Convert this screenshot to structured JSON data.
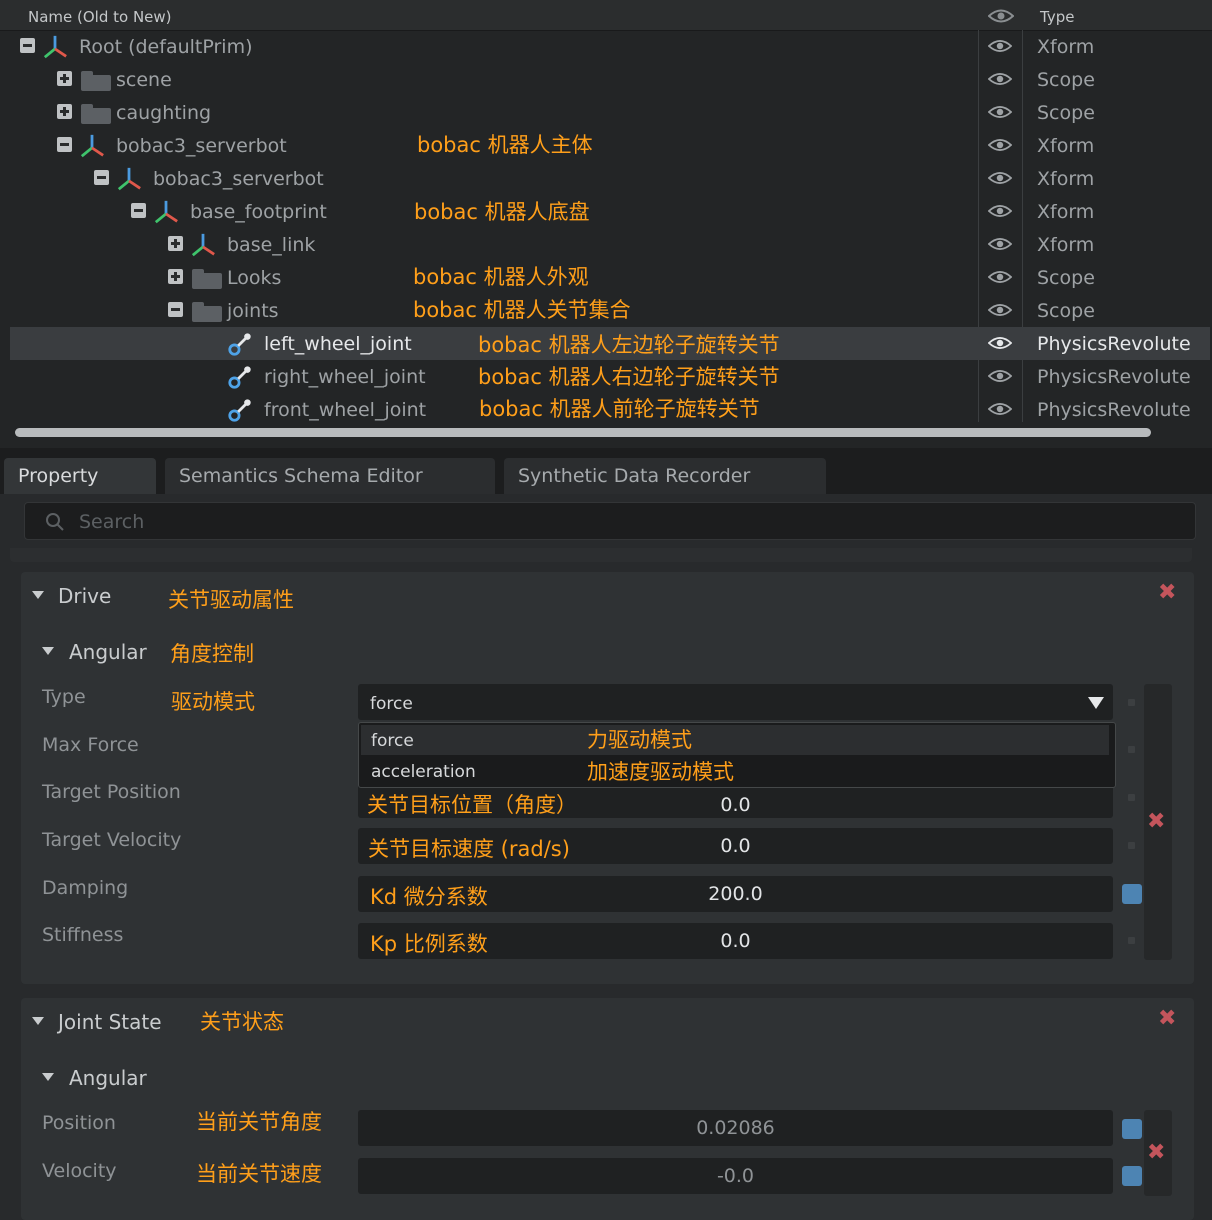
{
  "stage": {
    "columns": {
      "name": "Name (Old to New)",
      "type": "Type"
    },
    "rows": [
      {
        "name": "Root (defaultPrim)",
        "type": "Xform",
        "icon": "xform-axes-icon",
        "expander": "minus"
      },
      {
        "name": "scene",
        "type": "Scope",
        "icon": "folder-icon",
        "expander": "plus"
      },
      {
        "name": "caughting",
        "type": "Scope",
        "icon": "folder-icon",
        "expander": "plus"
      },
      {
        "name": "bobac3_serverbot",
        "type": "Xform",
        "icon": "xform-axes-icon",
        "expander": "minus"
      },
      {
        "name": "bobac3_serverbot",
        "type": "Xform",
        "icon": "xform-axes-icon",
        "expander": "minus"
      },
      {
        "name": "base_footprint",
        "type": "Xform",
        "icon": "xform-axes-icon",
        "expander": "minus"
      },
      {
        "name": "base_link",
        "type": "Xform",
        "icon": "xform-axes-icon",
        "expander": "plus"
      },
      {
        "name": "Looks",
        "type": "Scope",
        "icon": "folder-icon",
        "expander": "plus"
      },
      {
        "name": "joints",
        "type": "Scope",
        "icon": "folder-icon",
        "expander": "minus"
      },
      {
        "name": "left_wheel_joint",
        "type": "PhysicsRevolute",
        "icon": "joint-icon",
        "selected": true
      },
      {
        "name": "right_wheel_joint",
        "type": "PhysicsRevolute",
        "icon": "joint-icon"
      },
      {
        "name": "front_wheel_joint",
        "type": "PhysicsRevolute",
        "icon": "joint-icon"
      }
    ],
    "annotations": {
      "main_body": "bobac 机器人主体",
      "chassis": "bobac 机器人底盘",
      "looks": "bobac 机器人外观",
      "joints": "bobac 机器人关节集合",
      "left_wheel": "bobac 机器人左边轮子旋转关节",
      "right_wheel": "bobac 机器人右边轮子旋转关节",
      "front_wheel": "bobac 机器人前轮子旋转关节"
    }
  },
  "tabs": [
    "Property",
    "Semantics Schema Editor",
    "Synthetic Data Recorder"
  ],
  "search": {
    "placeholder": "Search"
  },
  "drive": {
    "title": "Drive",
    "title_note": "关节驱动属性",
    "angular_title": "Angular",
    "angular_note": "角度控制",
    "type": {
      "label": "Type",
      "note": "驱动模式",
      "value": "force"
    },
    "dropdown_options": [
      {
        "label": "force",
        "note": "力驱动模式"
      },
      {
        "label": "acceleration",
        "note": "加速度驱动模式"
      }
    ],
    "max_force": {
      "label": "Max Force"
    },
    "target_position": {
      "label": "Target Position",
      "note": "关节目标位置（角度）",
      "value": "0.0"
    },
    "target_velocity": {
      "label": "Target Velocity",
      "note": "关节目标速度 (rad/s)",
      "value": "0.0"
    },
    "damping": {
      "label": "Damping",
      "note": "Kd 微分系数",
      "value": "200.0"
    },
    "stiffness": {
      "label": "Stiffness",
      "note": "Kp 比例系数",
      "value": "0.0"
    }
  },
  "joint_state": {
    "title": "Joint State",
    "title_note": "关节状态",
    "angular_title": "Angular",
    "position": {
      "label": "Position",
      "note": "当前关节角度",
      "value": "0.02086"
    },
    "velocity": {
      "label": "Velocity",
      "note": "当前关节速度",
      "value": "-0.0"
    }
  }
}
